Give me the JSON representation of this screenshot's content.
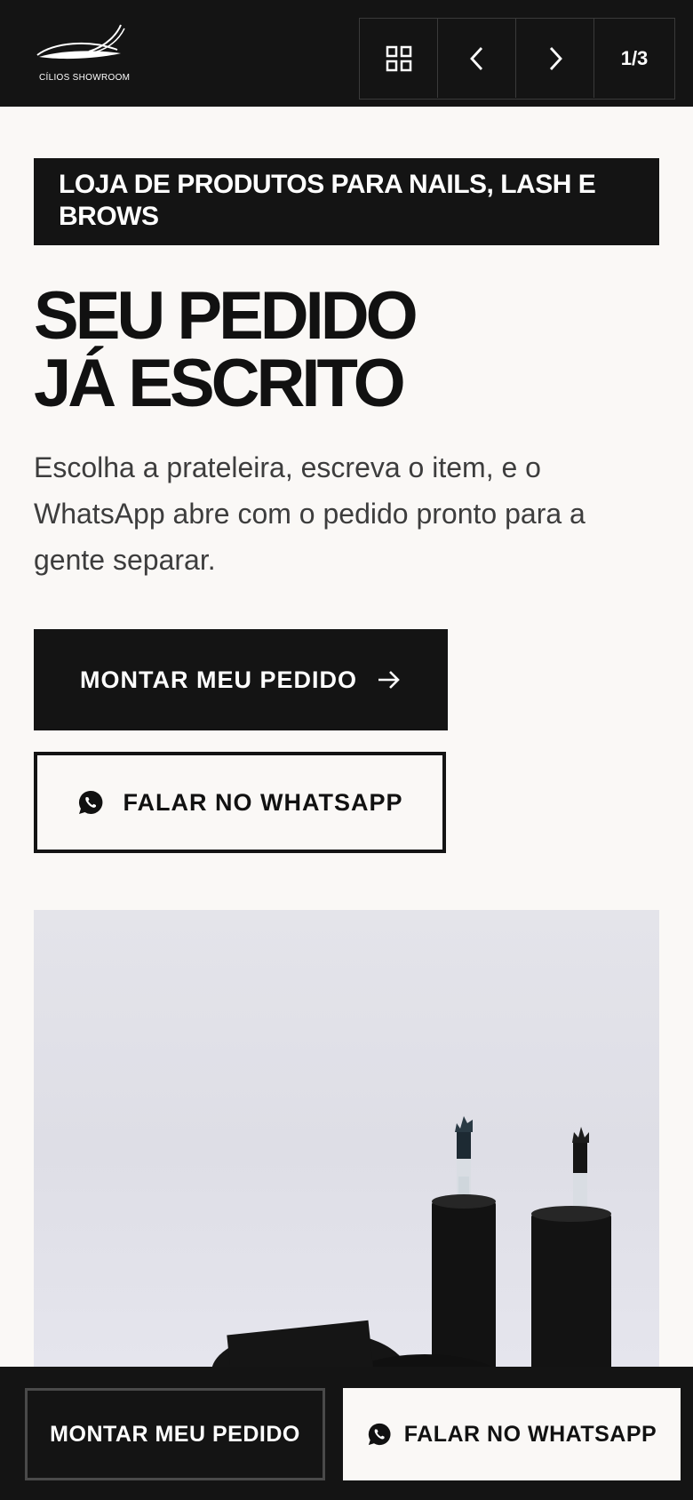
{
  "header": {
    "logo_text": "CÍLIOS SHOWROOM",
    "grid_icon": "grid-icon",
    "prev_icon": "chevron-left-icon",
    "next_icon": "chevron-right-icon",
    "page_indicator": "1/3"
  },
  "hero": {
    "badge": "LOJA DE PRODUTOS PARA NAILS, LASH E BROWS",
    "headline_line1": "SEU PEDIDO",
    "headline_line2": "JÁ ESCRITO",
    "intro": "Escolha a prateleira, escreva o item, e o WhatsApp abre com o pedido pronto para a gente separar."
  },
  "actions": {
    "primary_label": "MONTAR MEU PEDIDO",
    "primary_icon": "arrow-right-icon",
    "secondary_label": "FALAR NO WHATSAPP",
    "secondary_icon": "whatsapp-icon"
  },
  "bottom_bar": {
    "left_label": "MONTAR MEU PEDIDO",
    "right_label": "FALAR NO WHATSAPP",
    "right_icon": "whatsapp-icon"
  },
  "colors": {
    "dark": "#141414",
    "light": "#faf8f6",
    "text_muted": "#3d3d3d"
  }
}
